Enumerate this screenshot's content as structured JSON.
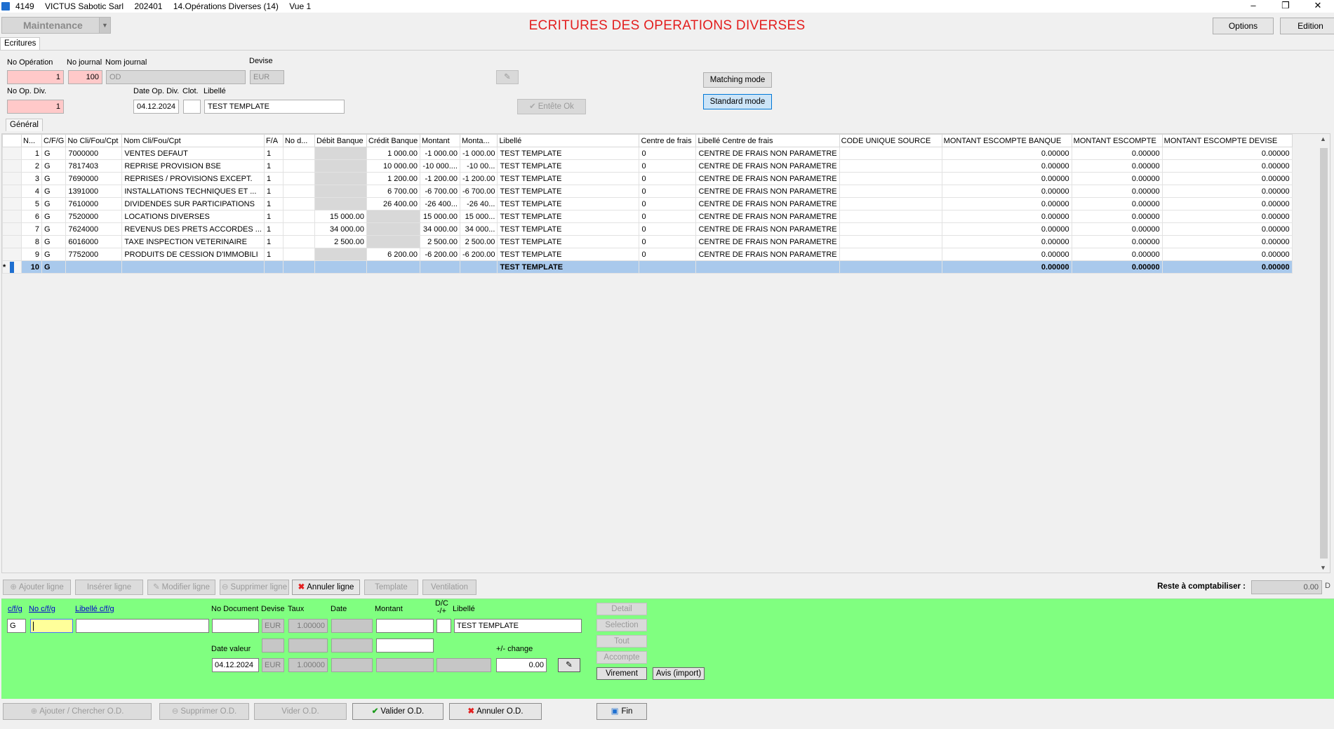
{
  "window": {
    "title_parts": [
      "4149",
      "VICTUS Sabotic Sarl",
      "202401",
      "14.Opérations Diverses (14)",
      "Vue 1"
    ],
    "controls": [
      "–",
      "❐",
      "✕"
    ]
  },
  "toolbar": {
    "mode_combo": "Maintenance",
    "page_title": "ECRITURES DES OPERATIONS DIVERSES",
    "options_label": "Options",
    "edition_label": "Edition"
  },
  "tabs": {
    "ecritures": "Ecritures",
    "general": "Général"
  },
  "header": {
    "no_operation_label": "No Opération",
    "no_operation": "1",
    "no_journal_label": "No journal",
    "no_journal": "100",
    "nom_journal_label": "Nom journal",
    "nom_journal": "OD",
    "devise_label": "Devise",
    "devise": "EUR",
    "no_op_div_label": "No Op. Div.",
    "no_op_div": "1",
    "date_label": "Date Op. Div.",
    "date": "04.12.2024",
    "clot_label": "Clot.",
    "clot": "",
    "libelle_label": "Libellé",
    "libelle": "TEST TEMPLATE",
    "entete_ok": "Entête Ok",
    "matching_mode": "Matching mode",
    "standard_mode": "Standard mode"
  },
  "grid": {
    "columns": [
      "N...",
      "C/F/G",
      "No Cli/Fou/Cpt",
      "Nom Cli/Fou/Cpt",
      "F/A",
      "No d...",
      "Débit Banque",
      "Crédit Banque",
      "Montant",
      "Monta...",
      "Libellé",
      "Centre de frais",
      "Libellé Centre de frais",
      "CODE UNIQUE SOURCE",
      "MONTANT ESCOMPTE BANQUE",
      "MONTANT ESCOMPTE",
      "MONTANT ESCOMPTE DEVISE"
    ],
    "rows": [
      {
        "n": "1",
        "cfg": "G",
        "no": "7000000",
        "nom": "VENTES DEFAUT",
        "fa": "1",
        "nod": "",
        "debit": "",
        "credit": "1 000.00",
        "montant": "-1 000.00",
        "monta": "-1 000.00",
        "libelle": "TEST TEMPLATE",
        "cdf": "0",
        "lib_cdf": "CENTRE DE FRAIS NON PARAMETRE",
        "code": "",
        "meb": "0.00000",
        "me": "0.00000",
        "med": "0.00000"
      },
      {
        "n": "2",
        "cfg": "G",
        "no": "7817403",
        "nom": "REPRISE PROVISION BSE",
        "fa": "1",
        "nod": "",
        "debit": "",
        "credit": "10 000.00",
        "montant": "-10 000....",
        "monta": "-10 00...",
        "libelle": "TEST TEMPLATE",
        "cdf": "0",
        "lib_cdf": "CENTRE DE FRAIS NON PARAMETRE",
        "code": "",
        "meb": "0.00000",
        "me": "0.00000",
        "med": "0.00000"
      },
      {
        "n": "3",
        "cfg": "G",
        "no": "7690000",
        "nom": "REPRISES / PROVISIONS EXCEPT.",
        "fa": "1",
        "nod": "",
        "debit": "",
        "credit": "1 200.00",
        "montant": "-1 200.00",
        "monta": "-1 200.00",
        "libelle": "TEST TEMPLATE",
        "cdf": "0",
        "lib_cdf": "CENTRE DE FRAIS NON PARAMETRE",
        "code": "",
        "meb": "0.00000",
        "me": "0.00000",
        "med": "0.00000"
      },
      {
        "n": "4",
        "cfg": "G",
        "no": "1391000",
        "nom": "INSTALLATIONS TECHNIQUES ET ...",
        "fa": "1",
        "nod": "",
        "debit": "",
        "credit": "6 700.00",
        "montant": "-6 700.00",
        "monta": "-6 700.00",
        "libelle": "TEST TEMPLATE",
        "cdf": "0",
        "lib_cdf": "CENTRE DE FRAIS NON PARAMETRE",
        "code": "",
        "meb": "0.00000",
        "me": "0.00000",
        "med": "0.00000"
      },
      {
        "n": "5",
        "cfg": "G",
        "no": "7610000",
        "nom": "DIVIDENDES SUR PARTICIPATIONS",
        "fa": "1",
        "nod": "",
        "debit": "",
        "credit": "26 400.00",
        "montant": "-26 400...",
        "monta": "-26 40...",
        "libelle": "TEST TEMPLATE",
        "cdf": "0",
        "lib_cdf": "CENTRE DE FRAIS NON PARAMETRE",
        "code": "",
        "meb": "0.00000",
        "me": "0.00000",
        "med": "0.00000"
      },
      {
        "n": "6",
        "cfg": "G",
        "no": "7520000",
        "nom": "LOCATIONS DIVERSES",
        "fa": "1",
        "nod": "",
        "debit": "15 000.00",
        "credit": "",
        "montant": "15 000.00",
        "monta": "15 000...",
        "libelle": "TEST TEMPLATE",
        "cdf": "0",
        "lib_cdf": "CENTRE DE FRAIS NON PARAMETRE",
        "code": "",
        "meb": "0.00000",
        "me": "0.00000",
        "med": "0.00000"
      },
      {
        "n": "7",
        "cfg": "G",
        "no": "7624000",
        "nom": "REVENUS DES PRETS ACCORDES ...",
        "fa": "1",
        "nod": "",
        "debit": "34 000.00",
        "credit": "",
        "montant": "34 000.00",
        "monta": "34 000...",
        "libelle": "TEST TEMPLATE",
        "cdf": "0",
        "lib_cdf": "CENTRE DE FRAIS NON PARAMETRE",
        "code": "",
        "meb": "0.00000",
        "me": "0.00000",
        "med": "0.00000"
      },
      {
        "n": "8",
        "cfg": "G",
        "no": "6016000",
        "nom": "TAXE INSPECTION VETERINAIRE",
        "fa": "1",
        "nod": "",
        "debit": "2 500.00",
        "credit": "",
        "montant": "2 500.00",
        "monta": "2 500.00",
        "libelle": "TEST TEMPLATE",
        "cdf": "0",
        "lib_cdf": "CENTRE DE FRAIS NON PARAMETRE",
        "code": "",
        "meb": "0.00000",
        "me": "0.00000",
        "med": "0.00000"
      },
      {
        "n": "9",
        "cfg": "G",
        "no": "7752000",
        "nom": "PRODUITS DE CESSION D'IMMOBILI",
        "fa": "1",
        "nod": "",
        "debit": "",
        "credit": "6 200.00",
        "montant": "-6 200.00",
        "monta": "-6 200.00",
        "libelle": "TEST TEMPLATE",
        "cdf": "0",
        "lib_cdf": "CENTRE DE FRAIS NON PARAMETRE",
        "code": "",
        "meb": "0.00000",
        "me": "0.00000",
        "med": "0.00000"
      }
    ],
    "new_row": {
      "marker": "*",
      "n": "10",
      "cfg": "G",
      "libelle": "TEST TEMPLATE",
      "meb": "0.00000",
      "me": "0.00000",
      "med": "0.00000"
    }
  },
  "line_buttons": {
    "ajouter": "Ajouter ligne",
    "inserer": "Insérer ligne",
    "modifier": "Modifier ligne",
    "supprimer": "Supprimer ligne",
    "annuler": "Annuler ligne",
    "template": "Template",
    "ventilation": "Ventilation",
    "reste_label": "Reste à comptabiliser :",
    "reste_value": "0.00",
    "reste_suffix": "D"
  },
  "entry": {
    "cfg_label": "c/f/g",
    "nocfg_label": "No c/f/g",
    "libcfg_label": "Libellé c/f/g",
    "nodoc_label": "No Document",
    "devise_label": "Devise",
    "taux_label": "Taux",
    "date_label": "Date",
    "montant_label": "Montant",
    "dc_label": "D/C\n-/+",
    "libelle_label": "Libellé",
    "cfg": "G",
    "nocfg": "",
    "libcfg": "",
    "nodoc": "",
    "devise": "EUR",
    "taux": "1.00000",
    "date": "",
    "montant": "",
    "dc": "",
    "libelle": "TEST TEMPLATE",
    "date_valeur_label": "Date valeur",
    "date_valeur": "04.12.2024",
    "devise2": "EUR",
    "taux2": "1.00000",
    "change_label": "+/- change",
    "change": "0.00",
    "detail": "Detail",
    "selection": "Selection",
    "tout": "Tout",
    "accompte": "Accompte",
    "virement": "Virement",
    "avis": "Avis (import)"
  },
  "bottom_buttons": {
    "ajouter_od": "Ajouter / Chercher O.D.",
    "supprimer_od": "Supprimer O.D.",
    "vider_od": "Vider O.D.",
    "valider_od": "Valider O.D.",
    "annuler_od": "Annuler O.D.",
    "fin": "Fin"
  },
  "colors": {
    "title_red": "#e31e1e",
    "entry_green": "#80ff80",
    "selected_row": "#a9c9ec",
    "pink_field": "#ffc9c9"
  }
}
